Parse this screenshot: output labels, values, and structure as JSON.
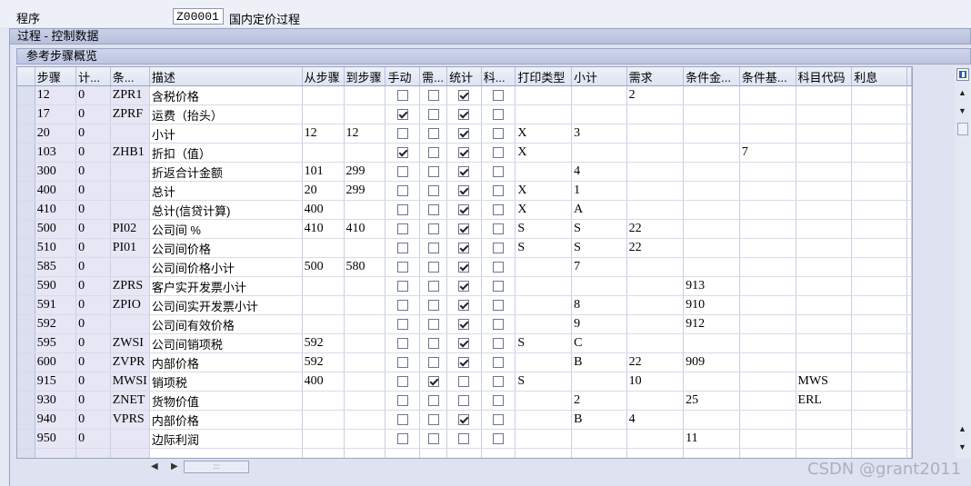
{
  "program": {
    "label": "程序",
    "code": "Z00001",
    "name": "国内定价过程"
  },
  "section_title": "过程 - 控制数据",
  "table_title": "参考步骤概览",
  "columns": [
    "步骤",
    "计...",
    "条...",
    "描述",
    "从步骤",
    "到步骤",
    "手动",
    "需...",
    "统计",
    "科...",
    "打印类型",
    "小计",
    "需求",
    "条件金...",
    "条件基...",
    "科目代码",
    "利息"
  ],
  "rows": [
    {
      "step": "12",
      "counter": "0",
      "cond": "ZPR1",
      "desc": "含税价格",
      "from": "",
      "to": "",
      "manual": false,
      "required": false,
      "statistical": true,
      "acct": false,
      "print": "",
      "subtotal": "",
      "requirement": "2",
      "alt_calc": "",
      "alt_base": "",
      "account_key": ""
    },
    {
      "step": "17",
      "counter": "0",
      "cond": "ZPRF",
      "desc": "运费（抬头）",
      "from": "",
      "to": "",
      "manual": true,
      "required": false,
      "statistical": true,
      "acct": false,
      "print": "",
      "subtotal": "",
      "requirement": "",
      "alt_calc": "",
      "alt_base": "",
      "account_key": ""
    },
    {
      "step": "20",
      "counter": "0",
      "cond": "",
      "desc": "小计",
      "from": "12",
      "to": "12",
      "manual": false,
      "required": false,
      "statistical": true,
      "acct": false,
      "print": "X",
      "subtotal": "3",
      "requirement": "",
      "alt_calc": "",
      "alt_base": "",
      "account_key": ""
    },
    {
      "step": "103",
      "counter": "0",
      "cond": "ZHB1",
      "desc": "折扣（值）",
      "from": "",
      "to": "",
      "manual": true,
      "required": false,
      "statistical": true,
      "acct": false,
      "print": "X",
      "subtotal": "",
      "requirement": "",
      "alt_calc": "",
      "alt_base": "7",
      "account_key": ""
    },
    {
      "step": "300",
      "counter": "0",
      "cond": "",
      "desc": "折返合计金额",
      "from": "101",
      "to": "299",
      "manual": false,
      "required": false,
      "statistical": true,
      "acct": false,
      "print": "",
      "subtotal": "4",
      "requirement": "",
      "alt_calc": "",
      "alt_base": "",
      "account_key": ""
    },
    {
      "step": "400",
      "counter": "0",
      "cond": "",
      "desc": "总计",
      "from": "20",
      "to": "299",
      "manual": false,
      "required": false,
      "statistical": true,
      "acct": false,
      "print": "X",
      "subtotal": "1",
      "requirement": "",
      "alt_calc": "",
      "alt_base": "",
      "account_key": ""
    },
    {
      "step": "410",
      "counter": "0",
      "cond": "",
      "desc": "总计(信贷计算)",
      "from": "400",
      "to": "",
      "manual": false,
      "required": false,
      "statistical": true,
      "acct": false,
      "print": "X",
      "subtotal": "A",
      "requirement": "",
      "alt_calc": "",
      "alt_base": "",
      "account_key": ""
    },
    {
      "step": "500",
      "counter": "0",
      "cond": "PI02",
      "desc": "公司间 %",
      "from": "410",
      "to": "410",
      "manual": false,
      "required": false,
      "statistical": true,
      "acct": false,
      "print": "S",
      "subtotal": "S",
      "requirement": "22",
      "alt_calc": "",
      "alt_base": "",
      "account_key": ""
    },
    {
      "step": "510",
      "counter": "0",
      "cond": "PI01",
      "desc": "公司间价格",
      "from": "",
      "to": "",
      "manual": false,
      "required": false,
      "statistical": true,
      "acct": false,
      "print": "S",
      "subtotal": "S",
      "requirement": "22",
      "alt_calc": "",
      "alt_base": "",
      "account_key": ""
    },
    {
      "step": "585",
      "counter": "0",
      "cond": "",
      "desc": "公司间价格小计",
      "from": "500",
      "to": "580",
      "manual": false,
      "required": false,
      "statistical": true,
      "acct": false,
      "print": "",
      "subtotal": "7",
      "requirement": "",
      "alt_calc": "",
      "alt_base": "",
      "account_key": ""
    },
    {
      "step": "590",
      "counter": "0",
      "cond": "ZPRS",
      "desc": "客户实开发票小计",
      "from": "",
      "to": "",
      "manual": false,
      "required": false,
      "statistical": true,
      "acct": false,
      "print": "",
      "subtotal": "",
      "requirement": "",
      "alt_calc": "913",
      "alt_base": "",
      "account_key": ""
    },
    {
      "step": "591",
      "counter": "0",
      "cond": "ZPIO",
      "desc": "公司间实开发票小计",
      "from": "",
      "to": "",
      "manual": false,
      "required": false,
      "statistical": true,
      "acct": false,
      "print": "",
      "subtotal": "8",
      "requirement": "",
      "alt_calc": "910",
      "alt_base": "",
      "account_key": ""
    },
    {
      "step": "592",
      "counter": "0",
      "cond": "",
      "desc": "公司间有效价格",
      "from": "",
      "to": "",
      "manual": false,
      "required": false,
      "statistical": true,
      "acct": false,
      "print": "",
      "subtotal": "9",
      "requirement": "",
      "alt_calc": "912",
      "alt_base": "",
      "account_key": ""
    },
    {
      "step": "595",
      "counter": "0",
      "cond": "ZWSI",
      "desc": "公司间销项税",
      "from": "592",
      "to": "",
      "manual": false,
      "required": false,
      "statistical": true,
      "acct": false,
      "print": "S",
      "subtotal": "C",
      "requirement": "",
      "alt_calc": "",
      "alt_base": "",
      "account_key": ""
    },
    {
      "step": "600",
      "counter": "0",
      "cond": "ZVPR",
      "desc": "内部价格",
      "from": "592",
      "to": "",
      "manual": false,
      "required": false,
      "statistical": true,
      "acct": false,
      "print": "",
      "subtotal": "B",
      "requirement": "22",
      "alt_calc": "909",
      "alt_base": "",
      "account_key": ""
    },
    {
      "step": "915",
      "counter": "0",
      "cond": "MWSI",
      "desc": "销项税",
      "from": "400",
      "to": "",
      "manual": false,
      "required": true,
      "statistical": false,
      "acct": false,
      "print": "S",
      "subtotal": "",
      "requirement": "10",
      "alt_calc": "",
      "alt_base": "",
      "account_key": "MWS"
    },
    {
      "step": "930",
      "counter": "0",
      "cond": "ZNET",
      "desc": "货物价值",
      "from": "",
      "to": "",
      "manual": false,
      "required": false,
      "statistical": false,
      "acct": false,
      "print": "",
      "subtotal": "2",
      "requirement": "",
      "alt_calc": "25",
      "alt_base": "",
      "account_key": "ERL"
    },
    {
      "step": "940",
      "counter": "0",
      "cond": "VPRS",
      "desc": "内部价格",
      "from": "",
      "to": "",
      "manual": false,
      "required": false,
      "statistical": true,
      "acct": false,
      "print": "",
      "subtotal": "B",
      "requirement": "4",
      "alt_calc": "",
      "alt_base": "",
      "account_key": ""
    },
    {
      "step": "950",
      "counter": "0",
      "cond": "",
      "desc": "边际利润",
      "from": "",
      "to": "",
      "manual": false,
      "required": false,
      "statistical": false,
      "acct": false,
      "print": "",
      "subtotal": "",
      "requirement": "",
      "alt_calc": "11",
      "alt_base": "",
      "account_key": ""
    }
  ],
  "empty_rows": 1,
  "watermark": "CSDN @grant2011"
}
